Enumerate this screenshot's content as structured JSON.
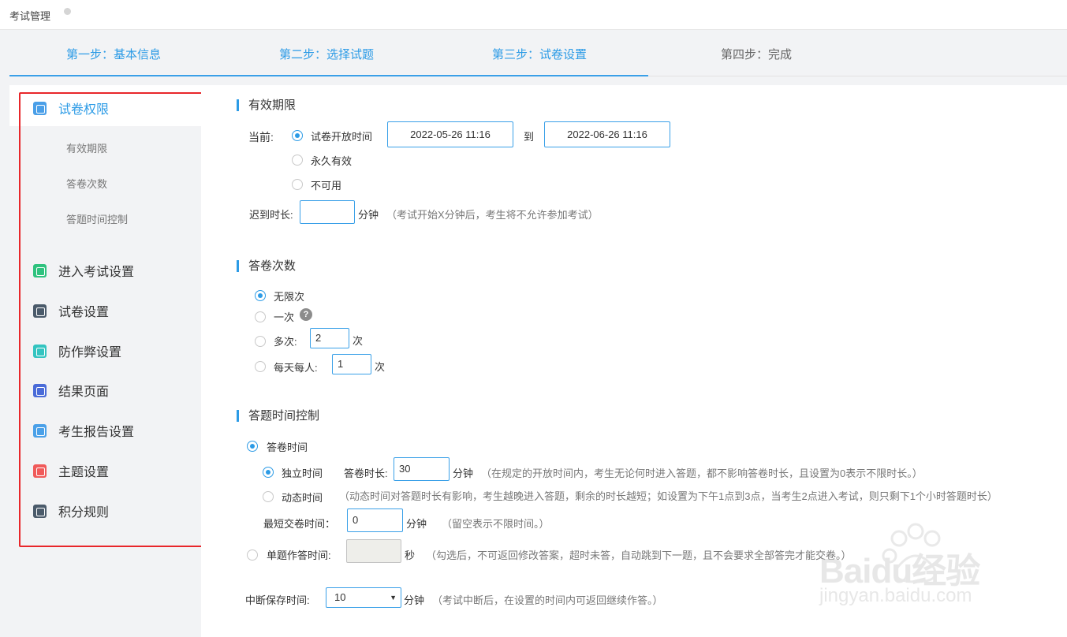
{
  "app": {
    "title": "考试管理"
  },
  "steps": [
    {
      "label": "第一步：基本信息"
    },
    {
      "label": "第二步：选择试题"
    },
    {
      "label": "第三步：试卷设置"
    },
    {
      "label": "第四步：完成"
    }
  ],
  "sidebar": {
    "items": [
      {
        "label": "试卷权限",
        "icon": "shield-icon",
        "color": "#4a9fe8"
      },
      {
        "label": "进入考试设置",
        "icon": "document-icon",
        "color": "#2ec27e"
      },
      {
        "label": "试卷设置",
        "icon": "paper-icon",
        "color": "#4a5a6a"
      },
      {
        "label": "防作弊设置",
        "icon": "shield-check-icon",
        "color": "#33c4c0"
      },
      {
        "label": "结果页面",
        "icon": "eye-icon",
        "color": "#4a6bd8"
      },
      {
        "label": "考生报告设置",
        "icon": "report-icon",
        "color": "#4aa0e8"
      },
      {
        "label": "主题设置",
        "icon": "shirt-icon",
        "color": "#f05a5a"
      },
      {
        "label": "积分规则",
        "icon": "gift-icon",
        "color": "#4a5a6a"
      }
    ],
    "subitems": [
      "有效期限",
      "答卷次数",
      "答题时间控制"
    ]
  },
  "validity": {
    "title": "有效期限",
    "current_label": "当前:",
    "opt_open": "试卷开放时间",
    "start": "2022-05-26 11:16",
    "to": "到",
    "end": "2022-06-26 11:16",
    "opt_forever": "永久有效",
    "opt_unavailable": "不可用",
    "late_label": "迟到时长:",
    "late_value": "",
    "late_unit": "分钟",
    "late_hint": "（考试开始X分钟后，考生将不允许参加考试）"
  },
  "attempts": {
    "title": "答卷次数",
    "opt_unlimited": "无限次",
    "opt_once": "一次",
    "opt_multi": "多次:",
    "multi_value": "2",
    "unit": "次",
    "opt_daily": "每天每人:",
    "daily_value": "1"
  },
  "timing": {
    "title": "答题时间控制",
    "opt_answer_time": "答卷时间",
    "opt_independent": "独立时间",
    "duration_label": "答卷时长:",
    "duration_value": "30",
    "unit_min": "分钟",
    "independent_hint": "（在规定的开放时间内，考生无论何时进入答题，都不影响答卷时长，且设置为0表示不限时长。）",
    "opt_dynamic": "动态时间",
    "dynamic_hint": "（动态时间对答题时长有影响，考生越晚进入答题，剩余的时长越短；如设置为下午1点到3点，当考生2点进入考试，则只剩下1个小时答题时长）",
    "min_submit_label": "最短交卷时间：",
    "min_submit_value": "0",
    "min_submit_hint": "（留空表示不限时间。）",
    "opt_single": "单题作答时间:",
    "single_value": "",
    "unit_sec": "秒",
    "single_hint": "（勾选后，不可返回修改答案，超时未答，自动跳到下一题，且不会要求全部答完才能交卷。）",
    "save_label": "中断保存时间:",
    "save_value": "10",
    "save_hint": "（考试中断后，在设置的时间内可返回继续作答。）"
  },
  "watermark": {
    "brand": "Baidu经验",
    "url": "jingyan.baidu.com"
  },
  "colors": {
    "accent": "#2c9be6",
    "highlight_box": "#e8262a"
  }
}
